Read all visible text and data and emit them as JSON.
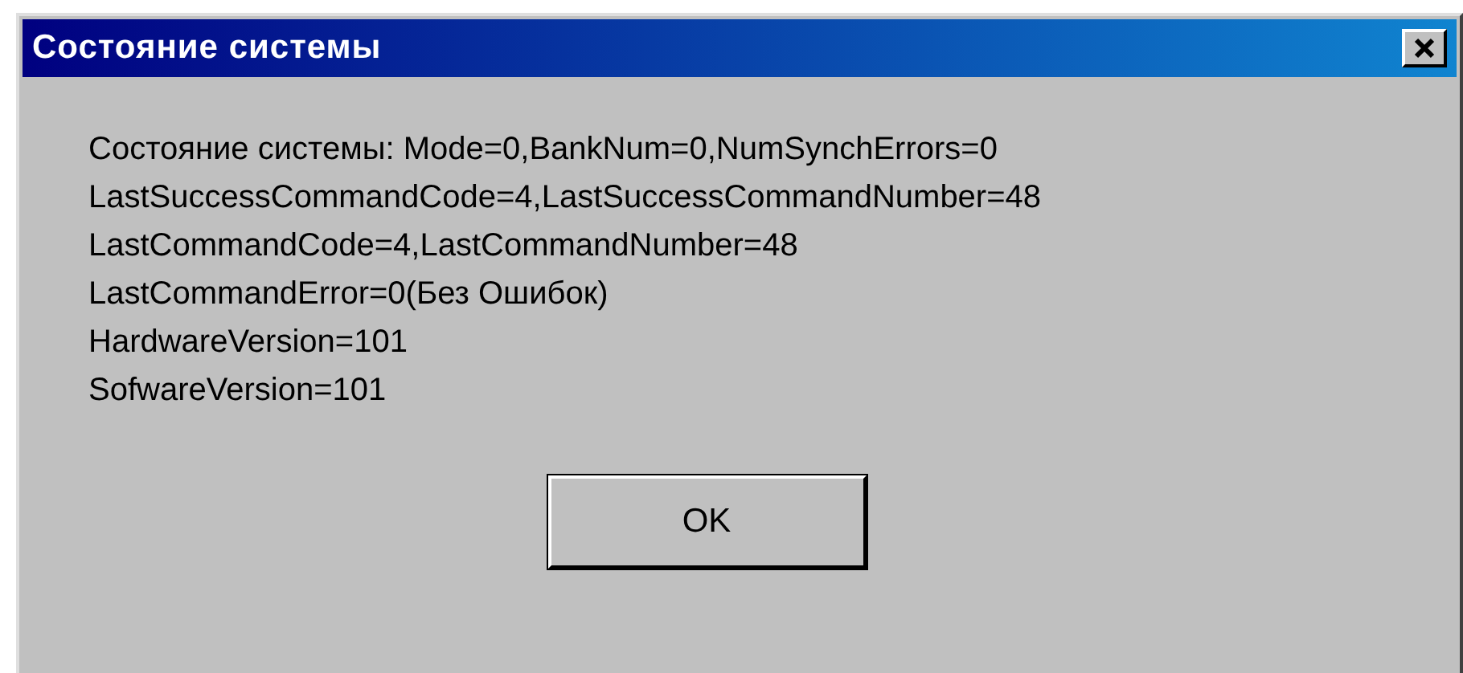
{
  "window": {
    "title": "Состояние системы"
  },
  "message_lines": [
    "Состояние системы: Mode=0,BankNum=0,NumSynchErrors=0",
    "LastSuccessCommandCode=4,LastSuccessCommandNumber=48",
    "LastCommandCode=4,LastCommandNumber=48",
    "LastCommandError=0(Без Ошибок)",
    "HardwareVersion=101",
    "SofwareVersion=101"
  ],
  "buttons": [
    "OK"
  ]
}
